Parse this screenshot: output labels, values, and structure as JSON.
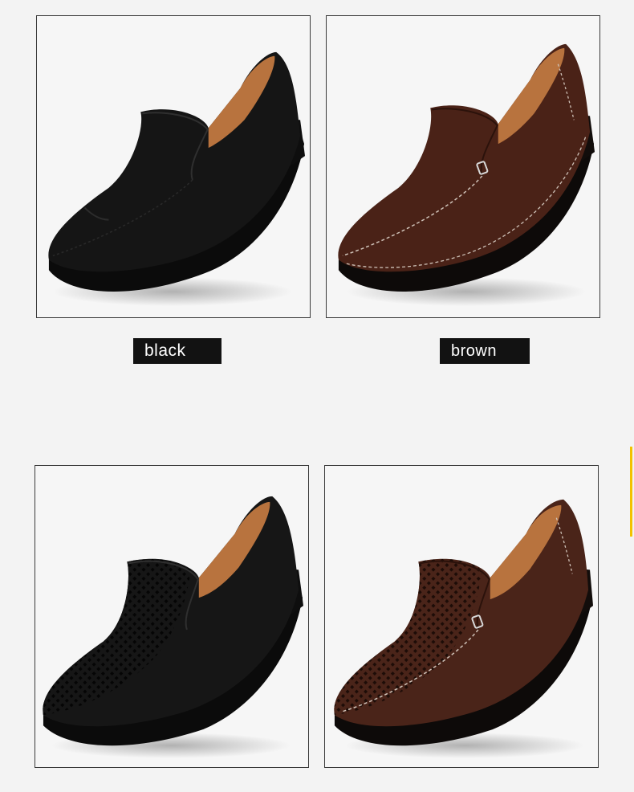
{
  "products": [
    {
      "label": "black",
      "style": "smooth",
      "upper_color": "#151515",
      "lining_color": "#b8733e",
      "stitch_color": "#2a2a2a"
    },
    {
      "label": "brown",
      "style": "smooth",
      "upper_color": "#4a2217",
      "lining_color": "#b8733e",
      "stitch_color": "#cfc2b8"
    },
    {
      "label": "",
      "style": "perforated",
      "upper_color": "#161616",
      "lining_color": "#b8733e",
      "stitch_color": "#2a2a2a"
    },
    {
      "label": "",
      "style": "perforated",
      "upper_color": "#4a2419",
      "lining_color": "#b8733e",
      "stitch_color": "#cfc2b8"
    }
  ],
  "colors": {
    "label_bg": "#121212",
    "label_text": "#ffffff",
    "accent": "#f2c200",
    "frame_border": "#3a3a3a"
  }
}
